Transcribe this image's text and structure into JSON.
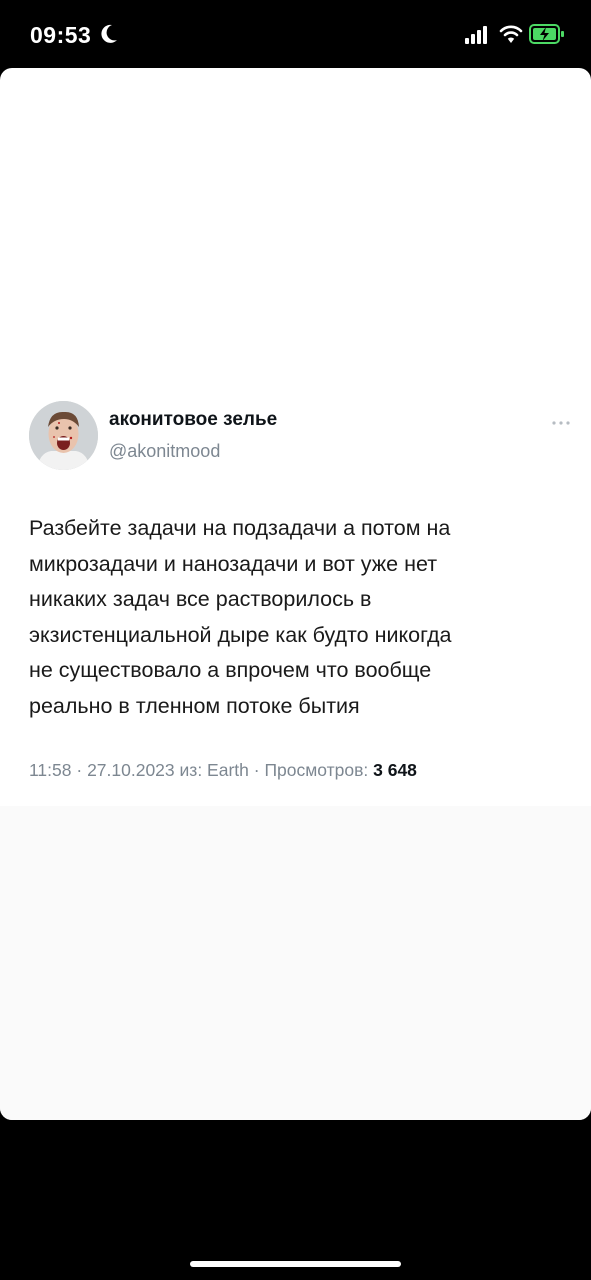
{
  "status_bar": {
    "time": "09:53",
    "icons": [
      "moon-icon",
      "signal-icon",
      "wifi-icon",
      "battery-charging-icon"
    ]
  },
  "tweet": {
    "display_name": "аконитовое зелье",
    "handle": "@akonitmood",
    "avatar": "avatar-photo-screaming-man",
    "text": "Разбейте задачи на подзадачи а потом на\nмикрозадачи и нанозадачи и вот уже нет\nникаких задач все растворилось в\nэкзистенциальной дыре как будто никогда\nне существовало а впрочем что вообще\nреально в тленном потоке бытия",
    "meta_time": "11:58",
    "meta_separator": " · ",
    "meta_date": "27.10.2023",
    "meta_source": " из: Earth",
    "meta_views_label": "Просмотров: ",
    "views_count": "3 648"
  },
  "colors": {
    "background": "#000000",
    "card": "#ffffff",
    "text_primary": "#0f1419",
    "text_secondary": "#7d8791",
    "battery_fill": "#4cd964"
  }
}
